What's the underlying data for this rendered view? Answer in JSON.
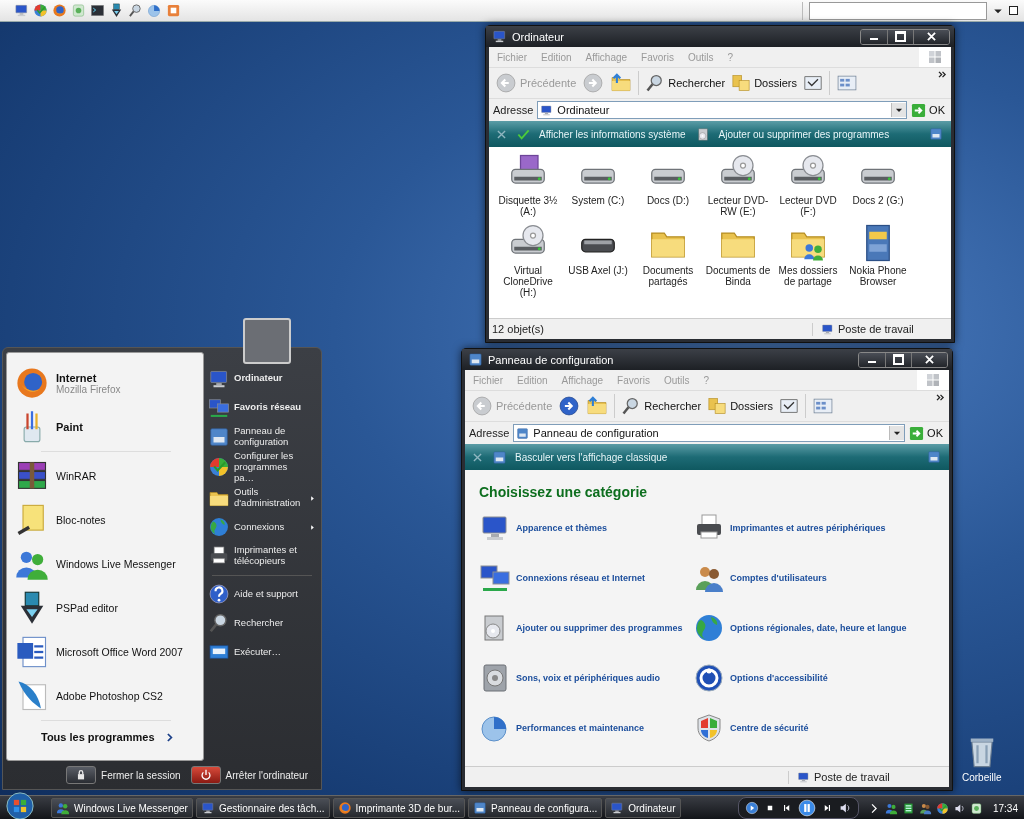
{
  "explorer_window": {
    "title": "Ordinateur",
    "menu": [
      "Fichier",
      "Edition",
      "Affichage",
      "Favoris",
      "Outils",
      "?"
    ],
    "toolbar": {
      "back": "Précédente",
      "forward_enabled": false,
      "search": "Rechercher",
      "folders": "Dossiers"
    },
    "address": {
      "label": "Adresse",
      "value": "Ordinateur",
      "go": "OK"
    },
    "tasks": [
      {
        "label": "Afficher les informations système",
        "kind": "check"
      },
      {
        "label": "Ajouter ou supprimer des programmes",
        "kind": "programs"
      }
    ],
    "items": [
      {
        "label": "Disquette 3½ (A:)",
        "kind": "floppy"
      },
      {
        "label": "System (C:)",
        "kind": "drive"
      },
      {
        "label": "Docs (D:)",
        "kind": "drive"
      },
      {
        "label": "Lecteur DVD-RW (E:)",
        "kind": "optical"
      },
      {
        "label": "Lecteur DVD (F:)",
        "kind": "optical"
      },
      {
        "label": "Docs 2 (G:)",
        "kind": "drive"
      },
      {
        "label": "Virtual CloneDrive (H:)",
        "kind": "optical"
      },
      {
        "label": "USB Axel (J:)",
        "kind": "usb"
      },
      {
        "label": "Documents partagés",
        "kind": "folder"
      },
      {
        "label": "Documents de Binda",
        "kind": "folder"
      },
      {
        "label": "Mes dossiers de partage",
        "kind": "shared"
      },
      {
        "label": "Nokia Phone Browser",
        "kind": "cabinet"
      }
    ],
    "status": {
      "count": "12 objet(s)",
      "zone": "Poste de travail"
    }
  },
  "control_panel_window": {
    "title": "Panneau de configuration",
    "menu": [
      "Fichier",
      "Edition",
      "Affichage",
      "Favoris",
      "Outils",
      "?"
    ],
    "toolbar": {
      "back": "Précédente",
      "forward_enabled": true,
      "search": "Rechercher",
      "folders": "Dossiers"
    },
    "address": {
      "label": "Adresse",
      "value": "Panneau de configuration",
      "go": "OK"
    },
    "tasks": [
      {
        "label": "Basculer vers l'affichage classique",
        "kind": "panel"
      }
    ],
    "heading": "Choisissez une catégorie",
    "categories": [
      {
        "label": "Apparence et thèmes",
        "kind": "monitor"
      },
      {
        "label": "Imprimantes et autres périphériques",
        "kind": "printer"
      },
      {
        "label": "Connexions réseau et Internet",
        "kind": "network"
      },
      {
        "label": "Comptes d'utilisateurs",
        "kind": "users"
      },
      {
        "label": "Ajouter ou supprimer des programmes",
        "kind": "programs"
      },
      {
        "label": "Options régionales, date, heure et langue",
        "kind": "globe"
      },
      {
        "label": "Sons, voix et périphériques audio",
        "kind": "speaker"
      },
      {
        "label": "Options d'accessibilité",
        "kind": "access"
      },
      {
        "label": "Performances et maintenance",
        "kind": "chart"
      },
      {
        "label": "Centre de sécurité",
        "kind": "shield"
      }
    ],
    "status": {
      "zone": "Poste de travail"
    }
  },
  "start_menu": {
    "pinned": [
      {
        "name": "Internet",
        "subtitle": "Mozilla Firefox",
        "kind": "firefox"
      },
      {
        "name": "Paint",
        "kind": "brushes"
      }
    ],
    "recent": [
      {
        "name": "WinRAR",
        "kind": "books"
      },
      {
        "name": "Bloc-notes",
        "kind": "notepad"
      },
      {
        "name": "Windows Live Messenger",
        "kind": "people"
      },
      {
        "name": "PSPad editor",
        "kind": "pen"
      },
      {
        "name": "Microsoft Office Word 2007",
        "kind": "word"
      },
      {
        "name": "Adobe Photoshop CS2",
        "kind": "feather"
      }
    ],
    "all_programs": "Tous les programmes",
    "places": [
      {
        "label": "Ordinateur",
        "bold": true,
        "submenu": false,
        "kind": "monitor"
      },
      {
        "label": "Favoris réseau",
        "bold": true,
        "submenu": false,
        "kind": "network"
      },
      {
        "label": "Panneau de configuration",
        "bold": false,
        "submenu": false,
        "kind": "panel"
      },
      {
        "label": "Configurer les programmes pa…",
        "bold": false,
        "submenu": false,
        "kind": "checkglobe"
      },
      {
        "label": "Outils d'administration",
        "bold": false,
        "submenu": true,
        "kind": "folder"
      },
      {
        "label": "Connexions",
        "bold": false,
        "submenu": true,
        "kind": "globe"
      },
      {
        "label": "Imprimantes et télécopieurs",
        "bold": false,
        "submenu": false,
        "kind": "printer"
      }
    ],
    "tools": [
      {
        "label": "Aide et support",
        "kind": "help"
      },
      {
        "label": "Rechercher",
        "kind": "magnifier"
      },
      {
        "label": "Exécuter…",
        "kind": "run"
      }
    ],
    "session_buttons": [
      {
        "label": "Fermer la session",
        "kind": "lock"
      },
      {
        "label": "Arrêter l'ordinateur",
        "kind": "power"
      }
    ]
  },
  "desktop_icons": [
    {
      "label": "Corbeille",
      "kind": "bin"
    }
  ],
  "taskbar": {
    "tasks": [
      {
        "label": "Windows Live Messenger",
        "kind": "people",
        "selected": false
      },
      {
        "label": "Gestionnaire des tâch...",
        "kind": "monitor",
        "selected": false
      },
      {
        "label": "Imprimante 3D de bur...",
        "kind": "firefox",
        "selected": false
      },
      {
        "label": "Panneau de configura...",
        "kind": "panel",
        "selected": false
      },
      {
        "label": "Ordinateur",
        "kind": "monitor",
        "selected": false
      }
    ],
    "clock": "17:34"
  }
}
